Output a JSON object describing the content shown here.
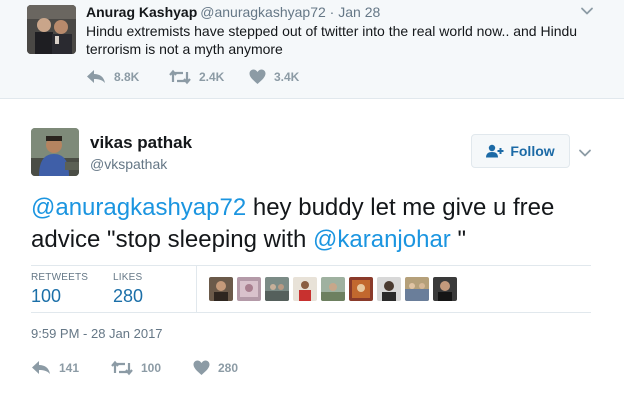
{
  "quoted_tweet": {
    "name": "Anurag Kashyap",
    "handle": "@anuragkashyap72",
    "date_sep": " · ",
    "date": "Jan 28",
    "text": "Hindu extremists have stepped out of twitter into the real world now.. and  Hindu terrorism is not a myth anymore",
    "replies": "8.8K",
    "retweets": "2.4K",
    "likes": "3.4K"
  },
  "tweet": {
    "name": "vikas pathak",
    "handle": "@vkspathak",
    "follow_label": "Follow",
    "text": {
      "mention1": "@anuragkashyap72",
      "mid": " hey buddy let me give u free advice \"stop sleeping with ",
      "mention2": "@karanjohar",
      "end": "  \""
    },
    "stats": {
      "retweets_label": "RETWEETS",
      "retweets": "100",
      "likes_label": "LIKES",
      "likes": "280"
    },
    "timestamp": "9:59 PM - 28 Jan 2017",
    "actions": {
      "replies": "141",
      "retweets": "100",
      "likes": "280"
    }
  },
  "icons": {
    "reply": "reply-icon",
    "retweet": "retweet-icon",
    "like": "heart-icon",
    "caret": "chevron-down-icon",
    "follow": "add-user-icon"
  },
  "colors": {
    "link": "#1b95e0",
    "stat_value": "#1b6fa8",
    "muted": "#657786",
    "action_icon": "#8c9ba5",
    "quoted_bg": "#f5f8fa"
  }
}
